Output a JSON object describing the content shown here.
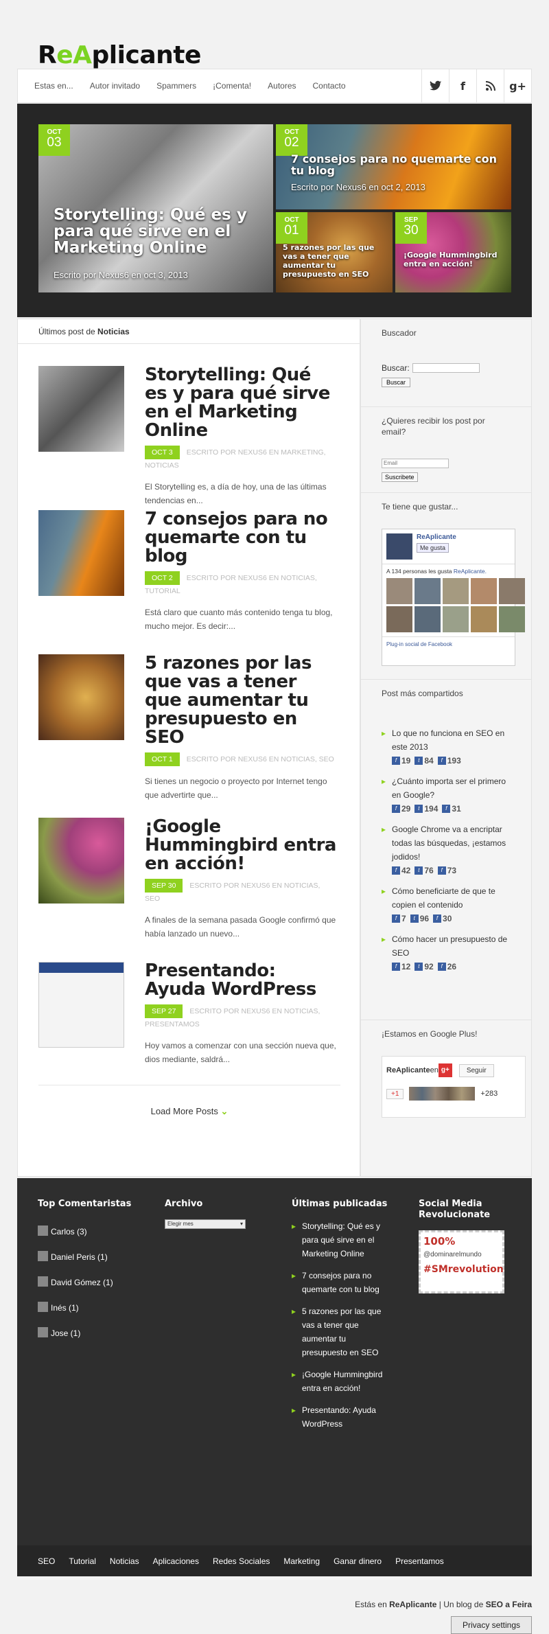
{
  "logo": {
    "part1": "R",
    "part2": "e",
    "part3": "A",
    "part4": "plicante"
  },
  "nav": {
    "items": [
      "Estas en...",
      "Autor invitado",
      "Spammers",
      "¡Comenta!",
      "Autores",
      "Contacto"
    ]
  },
  "social": {
    "icons": [
      "twitter-icon",
      "facebook-icon",
      "rss-icon",
      "google-plus-icon"
    ],
    "glyphs": [
      "t",
      "f",
      "~",
      "g+"
    ]
  },
  "hero": {
    "tiles": [
      {
        "month": "OCT",
        "day": "03",
        "title": "Storytelling: Qué es y para qué sirve en el Marketing Online",
        "byline": "Escrito por Nexus6 en oct 3, 2013"
      },
      {
        "month": "OCT",
        "day": "02",
        "title": "7 consejos para no quemarte con tu blog",
        "byline": "Escrito por Nexus6 en oct 2, 2013"
      },
      {
        "month": "OCT",
        "day": "01",
        "title": "5 razones por las que vas a tener que aumentar tu presupuesto en SEO",
        "byline": ""
      },
      {
        "month": "SEP",
        "day": "30",
        "title": "¡Google Hummingbird entra en acción!",
        "byline": ""
      }
    ]
  },
  "main": {
    "heading_pre": "Últimos post de ",
    "heading_bold": "Noticias",
    "posts": [
      {
        "title": "Storytelling: Qué es y para qué sirve en el Marketing Online",
        "date": "OCT 3",
        "meta": "ESCRITO POR NEXUS6 EN MARKETING, NOTICIAS",
        "excerpt": "El Storytelling es, a día de hoy, una de las últimas tendencias en..."
      },
      {
        "title": "7 consejos para no quemarte con tu blog",
        "date": "OCT 2",
        "meta": "ESCRITO POR NEXUS6 EN NOTICIAS, TUTORIAL",
        "excerpt": "Está claro que cuanto más contenido tenga tu blog, mucho mejor. Es decir:..."
      },
      {
        "title": "5 razones por las que vas a tener que aumentar tu presupuesto en SEO",
        "date": "OCT 1",
        "meta": "ESCRITO POR NEXUS6 EN NOTICIAS, SEO",
        "excerpt": "Si tienes un negocio o proyecto por Internet tengo que advertirte que..."
      },
      {
        "title": "¡Google Hummingbird entra en acción!",
        "date": "SEP 30",
        "meta": "ESCRITO POR NEXUS6 EN NOTICIAS, SEO",
        "excerpt": "A finales de la semana pasada Google confirmó que había lanzado un nuevo..."
      },
      {
        "title": "Presentando: Ayuda WordPress",
        "date": "SEP 27",
        "meta": "ESCRITO POR NEXUS6 EN NOTICIAS, PRESENTAMOS",
        "excerpt": "Hoy vamos a comenzar con una sección nueva que, dios mediante, saldrá..."
      }
    ],
    "load_more": "Load More Posts"
  },
  "sidebar": {
    "search_title": "Buscador",
    "search_label": "Buscar:",
    "search_button": "Buscar",
    "email_title": "¿Quieres recibir los post por email?",
    "email_placeholder": "Email",
    "email_button": "Suscribete",
    "fb_title": "Te tiene que gustar...",
    "fb_page": "ReAplicante",
    "fb_like": "Me gusta",
    "fb_count_pre": "A 134 personas les gusta ",
    "fb_count_link": "ReAplicante.",
    "fb_plugin": "Plug-in social de Facebook",
    "shared_title": "Post más compartidos",
    "shared": [
      {
        "title": "Lo que no funciona en SEO en este 2013",
        "c1": "19",
        "c2": "84",
        "c3": "193"
      },
      {
        "title": "¿Cuánto importa ser el primero en Google?",
        "c1": "29",
        "c2": "194",
        "c3": "31"
      },
      {
        "title": "Google Chrome va a encriptar todas las búsquedas, ¡estamos jodidos!",
        "c1": "42",
        "c2": "76",
        "c3": "73"
      },
      {
        "title": "Cómo beneficiarte de que te copien el contenido",
        "c1": "7",
        "c2": "96",
        "c3": "30"
      },
      {
        "title": "Cómo hacer un presupuesto de SEO",
        "c1": "12",
        "c2": "92",
        "c3": "26"
      }
    ],
    "gplus_title": "¡Estamos en Google Plus!",
    "gplus_name": "ReAplicante",
    "gplus_en": " en ",
    "gplus_follow": "Seguir",
    "gplus_plus1": "+1",
    "gplus_count": "+283"
  },
  "footer": {
    "top_title": "Top Comentaristas",
    "top": [
      "Carlos (3)",
      "Daniel Peris (1)",
      "David Gómez (1)",
      "Inés (1)",
      "Jose (1)"
    ],
    "archive_title": "Archivo",
    "archive_select": "Elegir mes",
    "latest_title": "Últimas publicadas",
    "latest": [
      "Storytelling: Qué es y para qué sirve en el Marketing Online",
      "7 consejos para no quemarte con tu blog",
      "5 razones por las que vas a tener que aumentar tu presupuesto en SEO",
      "¡Google Hummingbird entra en acción!",
      "Presentando: Ayuda WordPress"
    ],
    "social_title": "Social Media Revolucionate",
    "stamp": {
      "pct": "100%",
      "handle": "@dominarelmundo",
      "tag": "#SMrevolution"
    }
  },
  "bottom_nav": [
    "SEO",
    "Tutorial",
    "Noticias",
    "Aplicaciones",
    "Redes Sociales",
    "Marketing",
    "Ganar dinero",
    "Presentamos"
  ],
  "credit": {
    "pre": "Estás en ",
    "site": "ReAplicante",
    "mid": " | Un blog de ",
    "seo": "SEO a Feira"
  },
  "privacy": "Privacy settings",
  "colors": {
    "accent": "#8fd11f",
    "dark": "#2e2e2e"
  }
}
